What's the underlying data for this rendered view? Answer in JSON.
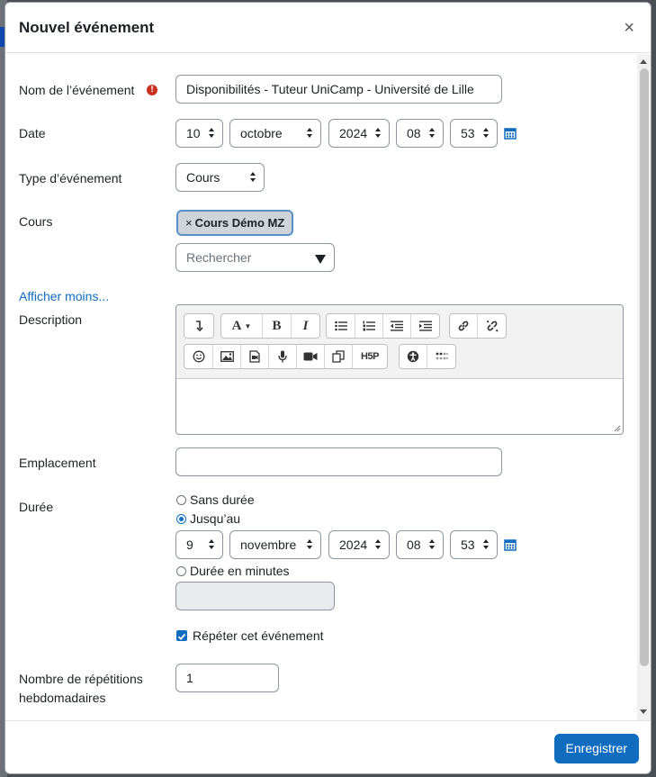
{
  "modal": {
    "title": "Nouvel événement",
    "close_label": "×"
  },
  "form": {
    "name": {
      "label": "Nom de l’événement",
      "value": "Disponibilités - Tuteur UniCamp - Université de Lille"
    },
    "date": {
      "label": "Date",
      "day": "10",
      "month": "octobre",
      "year": "2024",
      "hour": "08",
      "minute": "53"
    },
    "event_type": {
      "label": "Type d’événement",
      "value": "Cours"
    },
    "course": {
      "label": "Cours",
      "selected_tag": "Cours Démo MZ",
      "remove_symbol": "×",
      "search_placeholder": "Rechercher"
    },
    "show_less": "Afficher moins...",
    "description": {
      "label": "Description"
    },
    "location": {
      "label": "Emplacement",
      "value": ""
    },
    "duration": {
      "label": "Durée",
      "option_none": "Sans durée",
      "option_until": "Jusqu’au",
      "selected": "until",
      "until": {
        "day": "9",
        "month": "novembre",
        "year": "2024",
        "hour": "08",
        "minute": "53"
      },
      "option_minutes": "Durée en minutes"
    },
    "repeat": {
      "label": "Répéter cet événement",
      "checked": true
    },
    "weekly_repeats": {
      "label_line1": "Nombre de répétitions",
      "label_line2": "hebdomadaires",
      "value": "1"
    }
  },
  "editor_toolbar": {
    "row1": [
      "collapse-icon",
      "font-color-icon",
      "bold-icon",
      "italic-icon",
      "bullet-list-icon",
      "numbered-list-icon",
      "outdent-icon",
      "indent-icon",
      "link-icon",
      "unlink-icon"
    ],
    "row2": [
      "emoji-icon",
      "image-icon",
      "media-icon",
      "record-audio-icon",
      "record-video-icon",
      "manage-files-icon",
      "h5p-icon",
      "accessibility-checker-icon",
      "screenreader-helper-icon"
    ],
    "bold_glyph": "B",
    "italic_glyph": "I",
    "font_glyph": "A",
    "h5p_glyph": "H5P"
  },
  "footer": {
    "save_label": "Enregistrer"
  },
  "colors": {
    "primary": "#0f6cbf",
    "required": "#ca3120",
    "tag_border": "#5b8fc7"
  }
}
